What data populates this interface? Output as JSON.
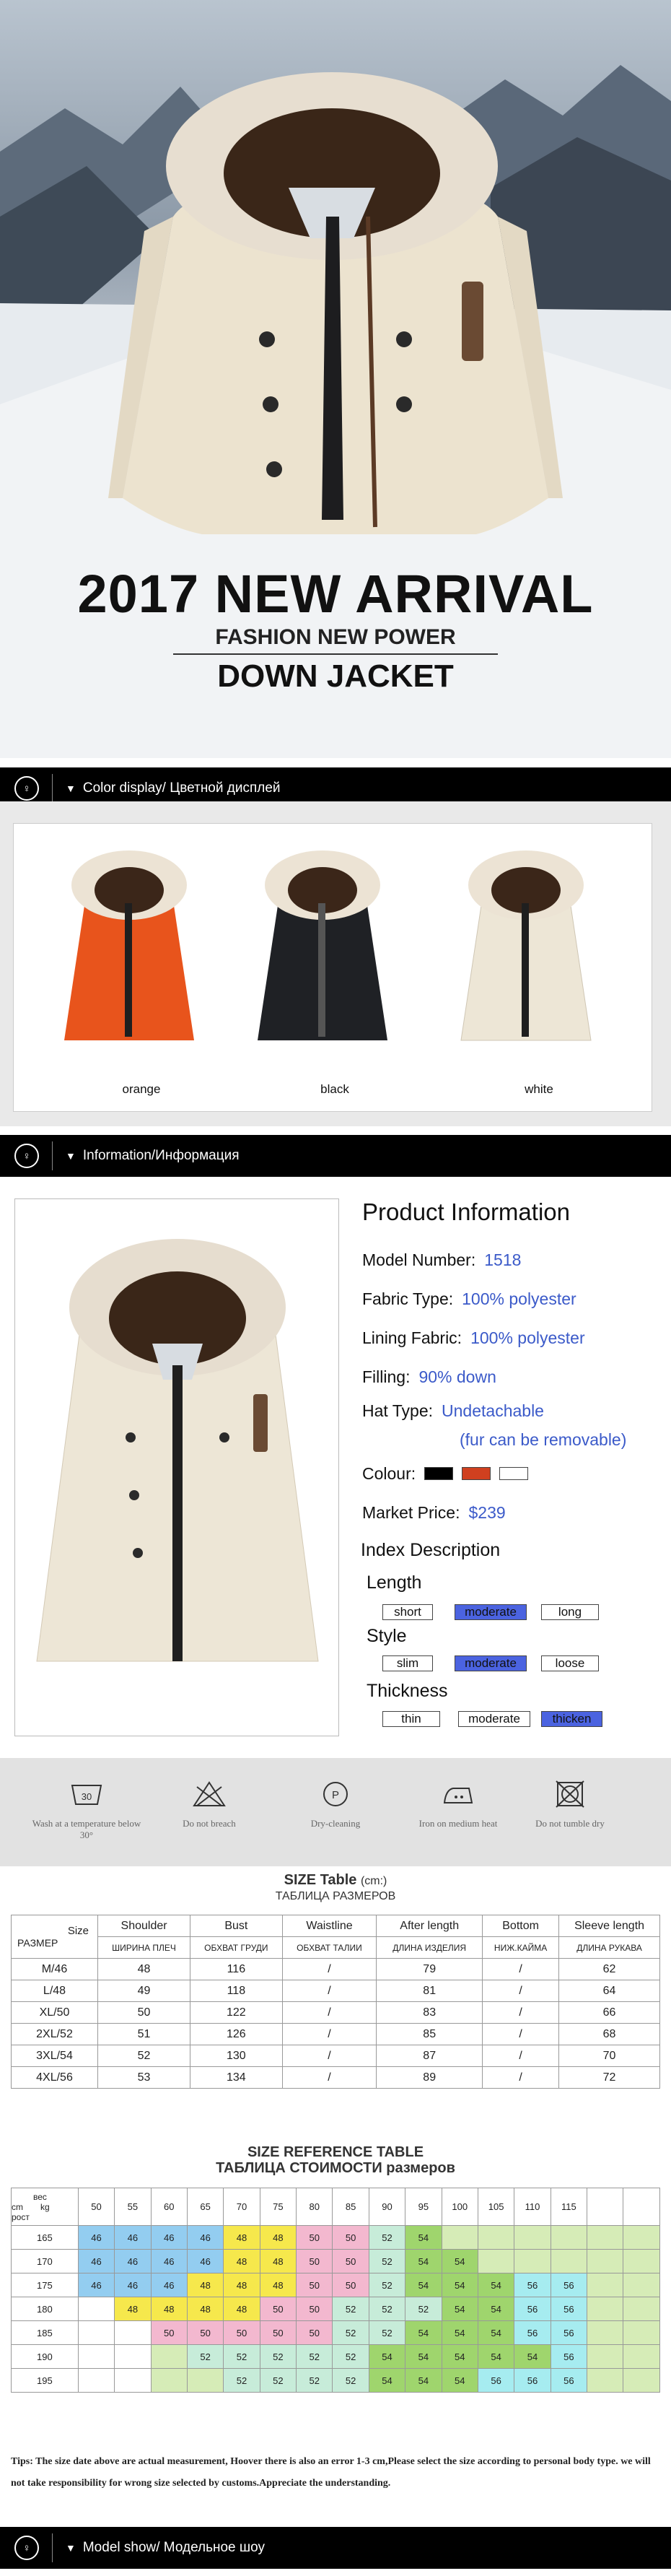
{
  "hero": {
    "title": "2017 NEW ARRIVAL",
    "subtitle": "FASHION NEW POWER",
    "subtitle2": "DOWN JACKET"
  },
  "sections": {
    "color": "Color display/ Цветной дисплей",
    "info": "Information/Информация",
    "model": "Model show/ Модельное шоу"
  },
  "colors": [
    {
      "label": "orange",
      "hex": "#e8541c"
    },
    {
      "label": "black",
      "hex": "#1f2125"
    },
    {
      "label": "white",
      "hex": "#ede6d6"
    }
  ],
  "product": {
    "heading": "Product Information",
    "rows": [
      {
        "label": "Model Number:",
        "value": "1518"
      },
      {
        "label": "Fabric Type:",
        "value": "100% polyester"
      },
      {
        "label": "Lining Fabric:",
        "value": "100% polyester"
      },
      {
        "label": "Filling:",
        "value": "90% down"
      },
      {
        "label": "Hat Type:",
        "value": "Undetachable"
      }
    ],
    "hat_note": "(fur can be removable)",
    "colour_label": "Colour:",
    "colour_swatches": [
      "#000000",
      "#d0401f",
      "#ffffff"
    ],
    "price_label": "Market Price:",
    "price": "$239"
  },
  "index": {
    "title": "Index Description",
    "groups": [
      {
        "label": "Length",
        "options": [
          "short",
          "moderate",
          "long"
        ],
        "selected": 1
      },
      {
        "label": "Style",
        "options": [
          "slim",
          "moderate",
          "loose"
        ],
        "selected": 1
      },
      {
        "label": "Thickness",
        "options": [
          "thin",
          "moderate",
          "thicken"
        ],
        "selected": 2
      }
    ]
  },
  "care": [
    {
      "text": "Wash at a temperature below 30°",
      "icon": "wash-30-icon"
    },
    {
      "text": "Do not breach",
      "icon": "no-bleach-icon"
    },
    {
      "text": "Dry-cleaning",
      "icon": "dry-clean-icon"
    },
    {
      "text": "Iron on medium heat",
      "icon": "iron-icon"
    },
    {
      "text": "Do not tumble dry",
      "icon": "no-tumble-dry-icon"
    }
  ],
  "size_table": {
    "title": "SIZE Table",
    "unit": "(cm:)",
    "title_ru": "ТАБЛИЦА РАЗМЕРОВ",
    "corner_top": "Size",
    "corner_bottom": "РАЗМЕР",
    "headers": [
      "Shoulder",
      "Bust",
      "Waistline",
      "After length",
      "Bottom",
      "Sleeve length"
    ],
    "headers_ru": [
      "ШИРИНА ПЛЕЧ",
      "ОБХВАТ ГРУДИ",
      "ОБХВАТ ТАЛИИ",
      "ДЛИНА ИЗДЕЛИЯ",
      "НИЖ.КАЙМА",
      "ДЛИНА РУКАВА"
    ],
    "rows": [
      [
        "M/46",
        "48",
        "116",
        "/",
        "79",
        "/",
        "62"
      ],
      [
        "L/48",
        "49",
        "118",
        "/",
        "81",
        "/",
        "64"
      ],
      [
        "XL/50",
        "50",
        "122",
        "/",
        "83",
        "/",
        "66"
      ],
      [
        "2XL/52",
        "51",
        "126",
        "/",
        "85",
        "/",
        "68"
      ],
      [
        "3XL/54",
        "52",
        "130",
        "/",
        "87",
        "/",
        "70"
      ],
      [
        "4XL/56",
        "53",
        "134",
        "/",
        "89",
        "/",
        "72"
      ]
    ]
  },
  "ref_table": {
    "title": "SIZE REFERENCE TABLE",
    "title_ru": "ТАБЛИЦА СТОИМОСТИ размеров",
    "weight_label": "вес",
    "kg_label": "kg",
    "cm_label": "cm",
    "height_label": "рост",
    "weights": [
      "50",
      "55",
      "60",
      "65",
      "70",
      "75",
      "80",
      "85",
      "90",
      "95",
      "100",
      "105",
      "110",
      "115"
    ],
    "rows": [
      {
        "h": "165",
        "cells": [
          "46",
          "46",
          "46",
          "46",
          "48",
          "48",
          "50",
          "50",
          "52",
          "54",
          "",
          "",
          "",
          "",
          "",
          ""
        ]
      },
      {
        "h": "170",
        "cells": [
          "46",
          "46",
          "46",
          "46",
          "48",
          "48",
          "50",
          "50",
          "52",
          "54",
          "54",
          "",
          "",
          "",
          "",
          ""
        ]
      },
      {
        "h": "175",
        "cells": [
          "46",
          "46",
          "46",
          "48",
          "48",
          "48",
          "50",
          "50",
          "52",
          "54",
          "54",
          "54",
          "56",
          "56",
          "",
          ""
        ]
      },
      {
        "h": "180",
        "cells": [
          "",
          "48",
          "48",
          "48",
          "48",
          "50",
          "50",
          "52",
          "52",
          "52",
          "54",
          "54",
          "56",
          "56",
          "",
          ""
        ]
      },
      {
        "h": "185",
        "cells": [
          "",
          "",
          "50",
          "50",
          "50",
          "50",
          "50",
          "52",
          "52",
          "54",
          "54",
          "54",
          "56",
          "56",
          "",
          ""
        ]
      },
      {
        "h": "190",
        "cells": [
          "",
          "",
          "",
          "52",
          "52",
          "52",
          "52",
          "52",
          "54",
          "54",
          "54",
          "54",
          "54",
          "56",
          "",
          ""
        ]
      },
      {
        "h": "195",
        "cells": [
          "",
          "",
          "",
          "",
          "52",
          "52",
          "52",
          "52",
          "54",
          "54",
          "54",
          "56",
          "56",
          "56",
          "",
          ""
        ]
      }
    ]
  },
  "tips": "Tips: The size date above are actual measurement, Hoover there is also an error 1-3 cm,Please select the size according to personal body type. we will not take responsibility for wrong size selected by customs.Appreciate the understanding."
}
